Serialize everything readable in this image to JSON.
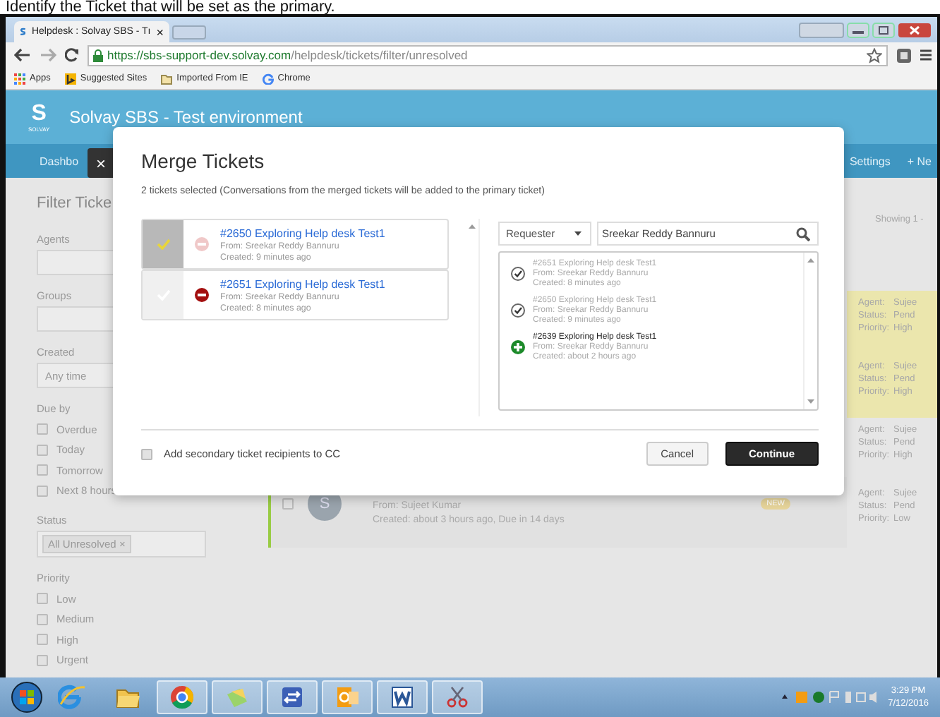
{
  "caption": "Identify the Ticket that will be set as the primary.",
  "browser": {
    "tab": {
      "title": "Helpdesk : Solvay SBS - Tı",
      "close": "×"
    },
    "url": {
      "host": "https://sbs-support-dev.solvay.com",
      "path": "/helpdesk/tickets/filter/unresolved"
    },
    "bookmarks": [
      {
        "kind": "apps",
        "label": "Apps"
      },
      {
        "kind": "bing",
        "label": "Suggested Sites"
      },
      {
        "kind": "folder",
        "label": "Imported From IE"
      },
      {
        "kind": "google",
        "label": "Chrome"
      }
    ]
  },
  "app": {
    "logo_mark": "S",
    "logo_text": "SOLVAY",
    "title": "Solvay SBS - Test environment",
    "nav_left": "Dashbo",
    "nav_right": [
      "Settings",
      "+ Ne"
    ]
  },
  "filters": {
    "title": "Filter Ticke",
    "groups": [
      {
        "kind": "field",
        "label": "Agents"
      },
      {
        "kind": "field",
        "label": "Groups"
      },
      {
        "kind": "select",
        "label": "Created",
        "value": "Any time"
      },
      {
        "kind": "checks",
        "label": "Due by",
        "options": [
          {
            "label": "Overdue",
            "checked": false
          },
          {
            "label": "Today",
            "checked": false
          },
          {
            "label": "Tomorrow",
            "checked": false
          },
          {
            "label": "Next 8 hours",
            "checked": false
          }
        ]
      },
      {
        "kind": "tags",
        "label": "Status",
        "tags": [
          {
            "label": "All Unresolved",
            "remove": "×"
          }
        ]
      },
      {
        "kind": "checks",
        "label": "Priority",
        "options": [
          {
            "label": "Low",
            "checked": false
          },
          {
            "label": "Medium",
            "checked": false
          },
          {
            "label": "High",
            "checked": false
          },
          {
            "label": "Urgent",
            "checked": false
          }
        ]
      }
    ]
  },
  "list": {
    "showing": "Showing 1 -",
    "card": {
      "checked": false,
      "avatar": "S",
      "from": "From: Sujeet Kumar",
      "created": "Created: about 3 hours ago, Due in 14 days",
      "badge": "NEW"
    },
    "tickets": [
      {
        "highlighted": true,
        "fields": [
          {
            "label": "Agent:",
            "value": "Sujee"
          },
          {
            "label": "Status:",
            "value": "Pend"
          },
          {
            "label": "Priority:",
            "value": "High"
          }
        ]
      },
      {
        "highlighted": true,
        "fields": [
          {
            "label": "Agent:",
            "value": "Sujee"
          },
          {
            "label": "Status:",
            "value": "Pend"
          },
          {
            "label": "Priority:",
            "value": "High"
          }
        ]
      },
      {
        "highlighted": false,
        "fields": [
          {
            "label": "Agent:",
            "value": "Sujee"
          },
          {
            "label": "Status:",
            "value": "Pend"
          },
          {
            "label": "Priority:",
            "value": "High"
          }
        ]
      },
      {
        "highlighted": false,
        "fields": [
          {
            "label": "Agent:",
            "value": "Sujee"
          },
          {
            "label": "Status:",
            "value": "Pend"
          },
          {
            "label": "Priority:",
            "value": "Low"
          }
        ]
      }
    ]
  },
  "modal": {
    "title": "Merge Tickets",
    "close": "×",
    "note": "2 tickets selected (Conversations from the merged tickets will be added to the primary ticket)",
    "selected_tickets": [
      {
        "title": "#2650 Exploring Help desk Test1",
        "from": "From: Sreekar Reddy Bannuru",
        "created": "Created: 9 minutes ago",
        "selected": true
      },
      {
        "title": "#2651 Exploring Help desk Test1",
        "from": "From: Sreekar Reddy Bannuru",
        "created": "Created: 8 minutes ago",
        "selected": false
      }
    ],
    "filter": {
      "field": "Requester",
      "query": "Sreekar Reddy Bannuru"
    },
    "results": [
      {
        "title": "#2651 Exploring Help desk Test1",
        "from": "From: Sreekar Reddy Bannuru",
        "created": "Created: 8 minutes ago",
        "added": true
      },
      {
        "title": "#2650 Exploring Help desk Test1",
        "from": "From: Sreekar Reddy Bannuru",
        "created": "Created: 9 minutes ago",
        "added": true
      },
      {
        "title": "#2639 Exploring Help desk Test1",
        "from": "From: Sreekar Reddy Bannuru",
        "created": "Created: about 2 hours ago",
        "added": false
      }
    ],
    "cc_option": {
      "label": "Add secondary ticket recipients to CC",
      "checked": false
    },
    "buttons": [
      {
        "label": "Cancel",
        "kind": "secondary"
      },
      {
        "label": "Continue",
        "kind": "primary"
      }
    ]
  },
  "taskbar": {
    "apps": [
      {
        "running": false
      },
      {
        "running": false
      },
      {
        "running": true
      },
      {
        "running": true
      },
      {
        "running": true
      },
      {
        "running": true
      },
      {
        "running": true
      },
      {
        "running": true
      }
    ],
    "time": "3:29 PM",
    "date": "7/12/2016"
  }
}
